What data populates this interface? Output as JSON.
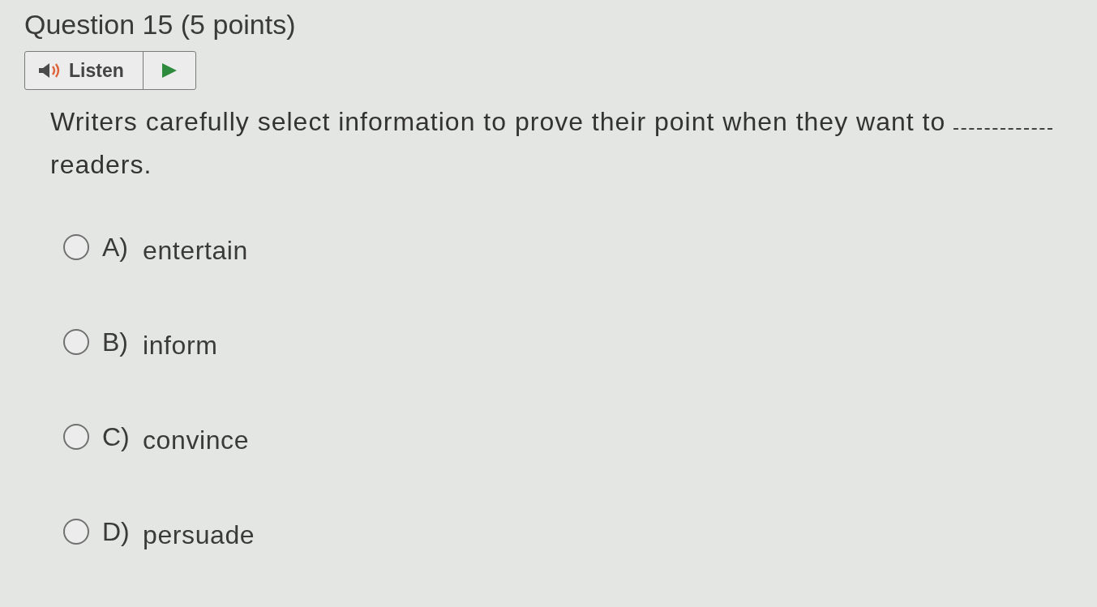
{
  "question": {
    "title": "Question 15 (5 points)",
    "listen": {
      "label": "Listen"
    },
    "text_before": "Writers carefully select information to prove their point when they want to",
    "text_after": "readers."
  },
  "options": [
    {
      "letter": "A)",
      "text": "entertain",
      "selected": false
    },
    {
      "letter": "B)",
      "text": "inform",
      "selected": false
    },
    {
      "letter": "C)",
      "text": "convince",
      "selected": false
    },
    {
      "letter": "D)",
      "text": "persuade",
      "selected": false
    }
  ]
}
